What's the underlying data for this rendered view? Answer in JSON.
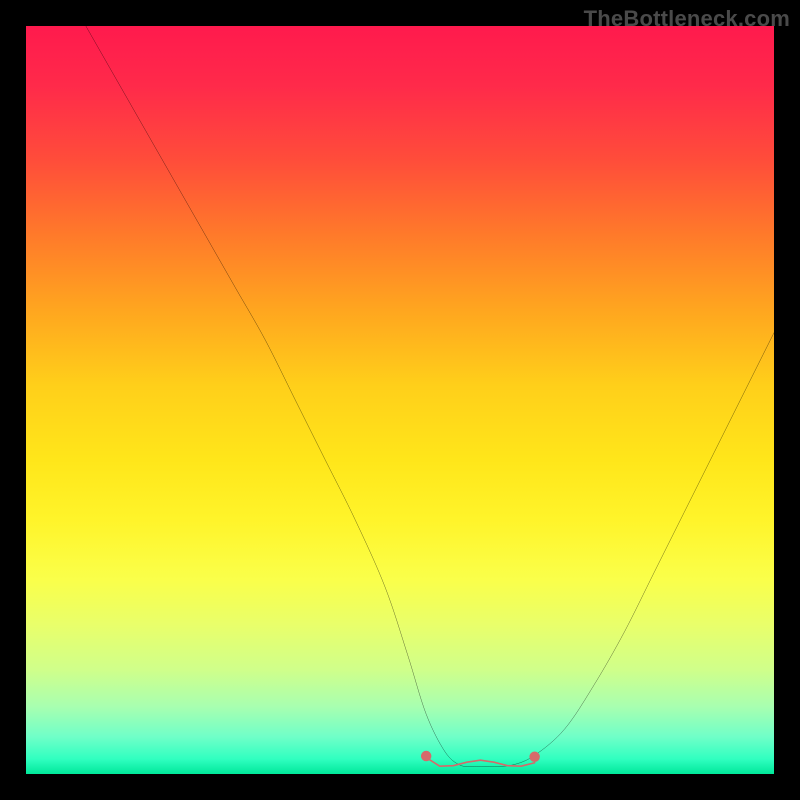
{
  "watermark": "TheBottleneck.com",
  "chart_data": {
    "type": "line",
    "title": "",
    "xlabel": "",
    "ylabel": "",
    "xlim": [
      0,
      100
    ],
    "ylim": [
      0,
      100
    ],
    "series": [
      {
        "name": "curve",
        "x": [
          8,
          12,
          16,
          20,
          24,
          28,
          32,
          36,
          40,
          44,
          48,
          51,
          53.5,
          56,
          58,
          60,
          62,
          65,
          68,
          72,
          76,
          80,
          84,
          88,
          92,
          96,
          100
        ],
        "values": [
          100,
          93,
          86,
          79,
          72,
          65,
          58,
          50,
          42,
          34,
          25,
          16,
          8,
          3,
          1.2,
          1,
          1,
          1.2,
          2.5,
          6,
          12,
          19,
          27,
          35,
          43,
          51,
          59
        ]
      }
    ],
    "highlight": {
      "name": "trough-marker",
      "color": "#d66a6a",
      "x_range": [
        53.5,
        68
      ],
      "y": 1.3
    },
    "colors": {
      "curve": "#000000",
      "marker": "#d66a6a",
      "background_top": "#ff1a4d",
      "background_bottom": "#00e89a",
      "frame": "#000000"
    }
  }
}
